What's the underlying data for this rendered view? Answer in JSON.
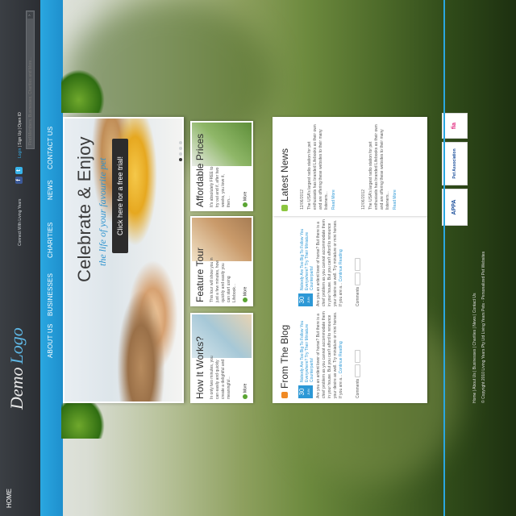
{
  "header": {
    "logo_text_1": "Demo",
    "logo_text_2": "Logo",
    "social_label": "Connect With Living Years",
    "login": "Login",
    "signup": "Sign Up",
    "open_id": "Open ID",
    "search_placeholder": "Find Members, Businesses, Charities and More...",
    "nav": [
      "HOME",
      "ABOUT US",
      "BUSINESSES",
      "CHARITIES",
      "NEWS",
      "CONTACT US"
    ]
  },
  "slider": {
    "title": "Celebrate & Enjoy",
    "subtitle": "the life of your favourite pet",
    "cta": "Click here for a free trial!",
    "dots": 4,
    "active_dot": 1
  },
  "features": [
    {
      "title": "How It Works?",
      "text": "In only two minutes, you can easily and quickly create a delightful and meaningful...",
      "more": "More"
    },
    {
      "title": "Feature Tour",
      "text": "This tour will show you in just a few minutes, how quickly and easily you can start using Lifebook...",
      "more": "More"
    },
    {
      "title": "Affordable Prices",
      "text": "It's absolutely FREE to try out and if, after two weeks, you love it, then...",
      "more": "More"
    }
  ],
  "blog": {
    "title": "From The Blog",
    "posts": [
      {
        "day": "30",
        "month": "JUN",
        "title": "Nobody Are Too Big To Follow You Everywhere? Try Their Miniature Counterparts!",
        "text": "Are you an ardent lover of horse? But there is a chief problem as you cannot accommodate them in your house. But you can't afford to renounce your desire as well. Try miniature or mini horses. If you are a...",
        "continue": "Continue Reading",
        "comments": "Comments"
      },
      {
        "day": "30",
        "month": "JUN",
        "title": "Nobody Are Too Big To Follow You Everywhere? Try Their Miniature Counterparts!",
        "text": "Are you an ardent lover of horse? But there is a chief problem as you cannot accommodate them in your house. But you can't afford to renounce your desire as well. Try miniature or mini horses. If you are a...",
        "continue": "Continue Reading",
        "comments": "Comments"
      }
    ]
  },
  "news": {
    "title": "Latest News",
    "items": [
      {
        "date": "12/06/2012",
        "text": "The USA's largest radio station for pet enthusiasts has branded Lifebooks as their own and are offering these websites to their many listeners...",
        "more": "Read More"
      },
      {
        "date": "12/06/2012",
        "text": "The USA's largest radio station for pet enthusiasts has branded Lifebooks as their own and are offering these websites to their many listeners...",
        "more": "Read More"
      }
    ]
  },
  "partners": [
    "APPA",
    "Pet Association",
    "fia"
  ],
  "footer": {
    "nav": "Home  |  About Us  |  Businesses  |  Charities  |  News  |  Contact Us",
    "copyright": "© Copyright 2010 Living Years Pty Ltd Living Years Pets - Personalized Pet Websites"
  }
}
